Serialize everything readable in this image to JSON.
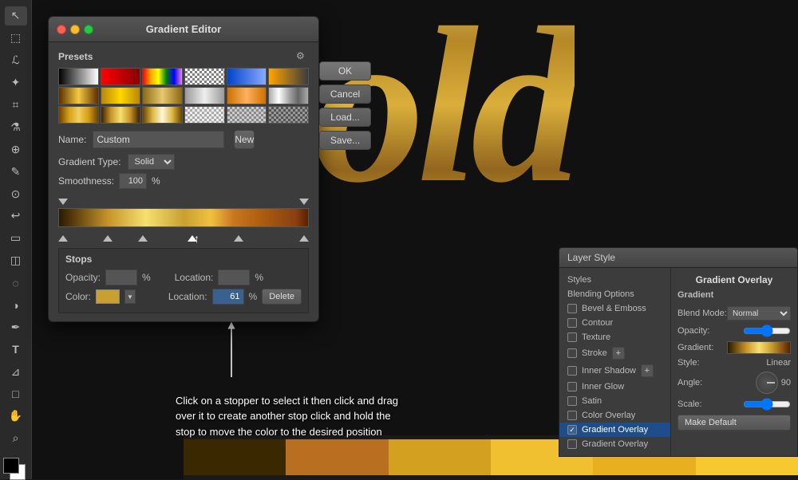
{
  "app": {
    "title": "Gradient Editor"
  },
  "toolbar": {
    "tools": [
      "M",
      "L",
      "T",
      "P",
      "B",
      "E",
      "S",
      "G",
      "D",
      "Z"
    ]
  },
  "dialog": {
    "title": "Gradient Editor",
    "presets_label": "Presets",
    "name_label": "Name:",
    "name_value": "Custom",
    "gradient_type_label": "Gradient Type:",
    "gradient_type_value": "Solid",
    "smoothness_label": "Smoothness:",
    "smoothness_value": "100",
    "smoothness_unit": "%",
    "stops_label": "Stops",
    "opacity_label": "Opacity:",
    "opacity_value": "",
    "location_label": "Location:",
    "location_value": "",
    "location_value2": "61",
    "delete_label": "Delete",
    "color_label": "Color:",
    "buttons": {
      "ok": "OK",
      "cancel": "Cancel",
      "load": "Load...",
      "save": "Save...",
      "new_btn": "New"
    }
  },
  "annotation": {
    "text": "Click on a stopper to select it then click and drag over it to create another stop click and hold the stop to move the color to the desired position"
  },
  "layer_style": {
    "panel_title": "Layer Style",
    "section_title": "Gradient Overlay",
    "sub_title": "Gradient",
    "items": [
      {
        "label": "Styles",
        "active": false
      },
      {
        "label": "Blending Options",
        "active": false
      },
      {
        "label": "Bevel & Emboss",
        "checked": false
      },
      {
        "label": "Contour",
        "checked": false
      },
      {
        "label": "Texture",
        "checked": false
      },
      {
        "label": "Stroke",
        "checked": false
      },
      {
        "label": "Inner Shadow",
        "checked": false
      },
      {
        "label": "Inner Glow",
        "checked": false
      },
      {
        "label": "Satin",
        "checked": false
      },
      {
        "label": "Color Overlay",
        "checked": false
      },
      {
        "label": "Gradient Overlay",
        "checked": true,
        "active": true
      },
      {
        "label": "Gradient Overlay",
        "checked": false
      }
    ],
    "blend_mode_label": "Blend Mode:",
    "blend_mode_value": "Normal",
    "opacity_label": "Opacity:",
    "gradient_label": "Gradient:",
    "style_label": "Style:",
    "style_value": "Linear",
    "angle_label": "Angle:",
    "angle_value": "90",
    "scale_label": "Scale:",
    "make_default": "Make Default"
  }
}
